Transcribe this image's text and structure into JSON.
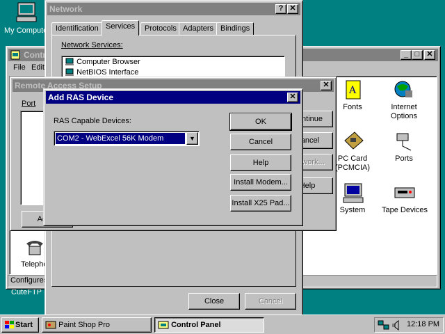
{
  "desktop": {
    "my_computer_label": "My Computer",
    "cuteftp_label": "CuteFTP"
  },
  "control_panel": {
    "title": "Control Panel",
    "menu": [
      "File",
      "Edit"
    ],
    "items": [
      {
        "label": "Fonts",
        "icon": "fonts-icon"
      },
      {
        "label": "Internet Options",
        "icon": "internet-options-icon"
      },
      {
        "label": "PC Card (PCMCIA)",
        "icon": "pc-card-icon"
      },
      {
        "label": "Ports",
        "icon": "ports-icon"
      },
      {
        "label": "System",
        "icon": "system-icon"
      },
      {
        "label": "Tape Devices",
        "icon": "tape-devices-icon"
      },
      {
        "label": "Telephony",
        "icon": "telephony-icon"
      }
    ],
    "status": "Configures"
  },
  "network": {
    "title": "Network",
    "tabs": [
      "Identification",
      "Services",
      "Protocols",
      "Adapters",
      "Bindings"
    ],
    "active_tab": "Services",
    "services_label": "Network Services:",
    "services": [
      "Computer Browser",
      "NetBIOS Interface"
    ],
    "close_label": "Close",
    "cancel_label": "Cancel"
  },
  "ras_setup": {
    "title": "Remote Access Setup",
    "port_label": "Port",
    "add_label": "Add...",
    "buttons": [
      "Continue",
      "Cancel",
      "Network...",
      "Help"
    ]
  },
  "add_ras": {
    "title": "Add RAS Device",
    "devices_label": "RAS Capable Devices:",
    "selected_device": "COM2 - WebExcel 56K Modem",
    "buttons": {
      "ok": "OK",
      "cancel": "Cancel",
      "help": "Help",
      "install_modem": "Install Modem...",
      "install_x25": "Install X25 Pad..."
    }
  },
  "taskbar": {
    "start_label": "Start",
    "tasks": [
      {
        "label": "Paint Shop Pro",
        "pressed": false
      },
      {
        "label": "Control Panel",
        "pressed": true
      }
    ],
    "clock": "12:18 PM"
  },
  "colors": {
    "desktop": "#008080",
    "title_active": "#000080",
    "title_inactive": "#808080",
    "face": "#c0c0c0"
  }
}
